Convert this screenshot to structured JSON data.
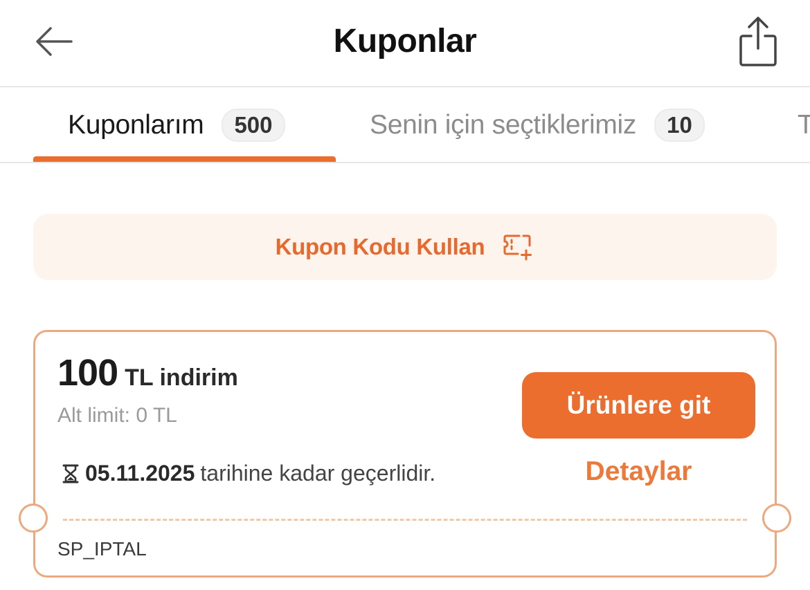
{
  "header": {
    "title": "Kuponlar",
    "back_icon": "arrow-left-icon",
    "share_icon": "share-icon"
  },
  "tabs": [
    {
      "label": "Kuponlarım",
      "count": "500",
      "active": true
    },
    {
      "label": "Senin için seçtiklerimiz",
      "count": "10",
      "active": false
    },
    {
      "label": "T",
      "active": false
    }
  ],
  "code_button": {
    "label": "Kupon Kodu Kullan",
    "icon": "coupon-add-icon"
  },
  "coupon": {
    "amount": "100",
    "amount_suffix": "TL indirim",
    "min_limit": "Alt limit: 0 TL",
    "valid_date": "05.11.2025",
    "valid_text": "tarihine kadar geçerlidir.",
    "validity_icon": "hourglass-icon",
    "go_button": "Ürünlere git",
    "details_link": "Detaylar",
    "code": "SP_IPTAL"
  },
  "colors": {
    "accent": "#eb6e2f",
    "accent_light_bg": "#fef4ee",
    "card_border": "#eda97d"
  }
}
